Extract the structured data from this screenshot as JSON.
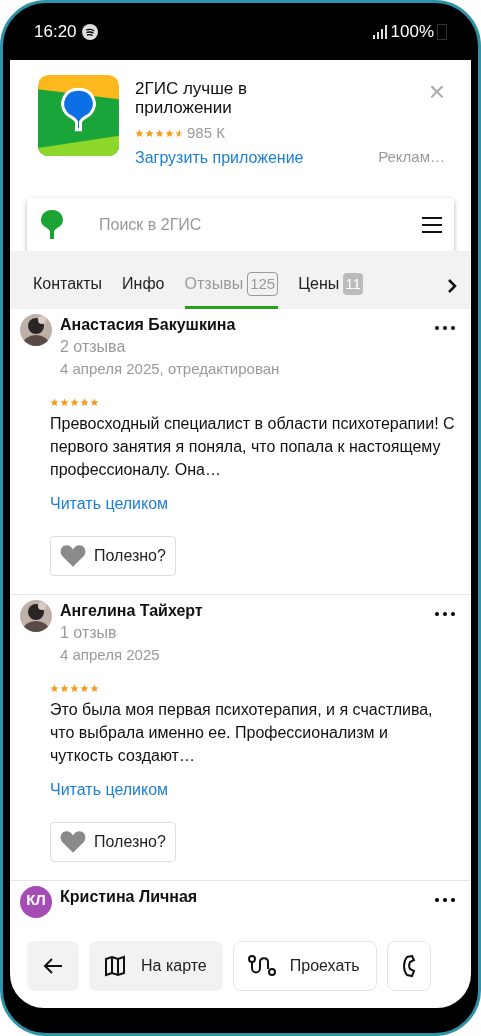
{
  "status_bar": {
    "time": "16:20",
    "battery": "100%"
  },
  "ad_banner": {
    "title": "2ГИС лучше в приложении",
    "stars": 4.5,
    "rating_count": "985 К",
    "link": "Загрузить приложение",
    "close": "×",
    "ad_label": "Реклам…"
  },
  "search": {
    "placeholder": "Поиск в 2ГИС"
  },
  "tabs": [
    {
      "label": "Контакты",
      "selected": false
    },
    {
      "label": "Инфо",
      "selected": false
    },
    {
      "label": "Отзывы",
      "count": "125",
      "selected": true
    },
    {
      "label": "Цены",
      "count": "11",
      "selected": false
    }
  ],
  "reviews": [
    {
      "name": "Анастасия Бакушкина",
      "review_count": "2 отзыва",
      "date": "4 апреля 2025, отредактирован",
      "stars": 5,
      "text": "Превосходный специалист в области психотерапии! С первого занятия я поняла, что попала к настоящему профессионалу. Она…",
      "read_more": "Читать целиком",
      "helpful": "Полезно?"
    },
    {
      "name": "Ангелина Тайхерт",
      "review_count": "1 отзыв",
      "date": "4 апреля 2025",
      "stars": 5,
      "text": "Это была моя первая психотерапия, и я счастлива, что выбрала именно ее. Профессионализм и чуткость создают…",
      "read_more": "Читать целиком",
      "helpful": "Полезно?"
    },
    {
      "avatar": {
        "kind": "initials",
        "text": "КЛ",
        "color": "#a54cb5"
      },
      "name": "Кристина Личная"
    }
  ],
  "bottom_bar": [
    {
      "kind": "back"
    },
    {
      "kind": "map",
      "label": "На карте"
    },
    {
      "kind": "route",
      "label": "Проехать"
    },
    {
      "kind": "call"
    }
  ]
}
